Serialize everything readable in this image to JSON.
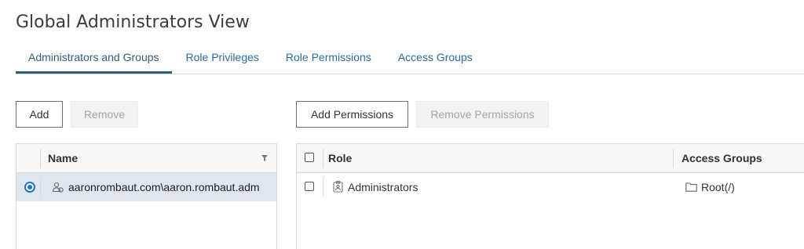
{
  "page": {
    "title": "Global Administrators View"
  },
  "tabs": [
    {
      "label": "Administrators and Groups",
      "active": true
    },
    {
      "label": "Role Privileges",
      "active": false
    },
    {
      "label": "Role Permissions",
      "active": false
    },
    {
      "label": "Access Groups",
      "active": false
    }
  ],
  "left_toolbar": {
    "add_label": "Add",
    "remove_label": "Remove"
  },
  "right_toolbar": {
    "add_permissions_label": "Add Permissions",
    "remove_permissions_label": "Remove Permissions"
  },
  "admins_table": {
    "header": {
      "name": "Name"
    },
    "rows": [
      {
        "name": "aaronrombaut.com\\aaron.rombaut.adm",
        "selected": true,
        "icon": "user-group-icon"
      }
    ]
  },
  "permissions_table": {
    "header": {
      "role": "Role",
      "access_groups": "Access Groups"
    },
    "rows": [
      {
        "role": "Administrators",
        "role_icon": "role-badge-icon",
        "access_group": "Root(/)",
        "access_group_icon": "folder-icon"
      }
    ]
  },
  "colors": {
    "tab_active": "#2f5e7b",
    "link": "#2b6d9e",
    "radio": "#1e73c8",
    "selected_row": "#dfe6ec"
  }
}
